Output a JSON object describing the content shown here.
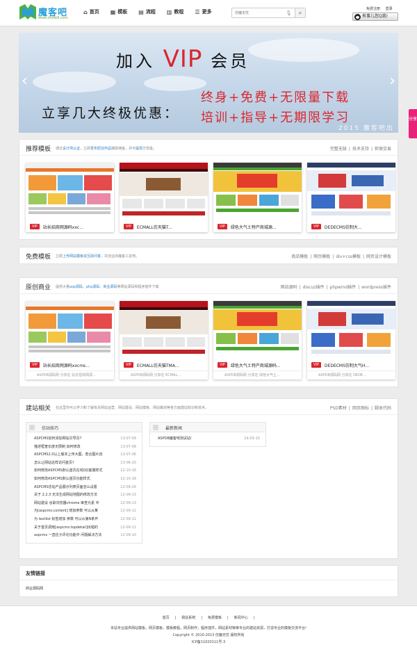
{
  "header": {
    "logo_text": "魔客吧",
    "logo_url": "www.moke8.com",
    "nav": [
      {
        "icon": "home-icon",
        "glyph": "⌂",
        "label": "首页"
      },
      {
        "icon": "grid-icon",
        "glyph": "▦",
        "label": "模板"
      },
      {
        "icon": "chart-icon",
        "glyph": "▤",
        "label": "流程"
      },
      {
        "icon": "book-icon",
        "glyph": "▥",
        "label": "教程"
      },
      {
        "icon": "menu-icon",
        "glyph": "☰",
        "label": "更多"
      }
    ],
    "search_placeholder": "仿魔无忧",
    "user_links": [
      "免费注册",
      "登录"
    ],
    "qq_label": "有事儿您Q我!"
  },
  "banner": {
    "line1_a": "加入",
    "line1_vip": "VIP",
    "line1_b": "会员",
    "line2": "立享几大终极优惠：",
    "red1": "终身+免费+无限量下载",
    "red2": "培训+指导+无期限学习",
    "year": "2015  魔客吧出品"
  },
  "share": "分享",
  "recommend": {
    "title": "推荐模板",
    "desc_a": "通过",
    "desc_b": "设计师认证",
    "desc_c": "，立即",
    "desc_d": "发布原创作品",
    "desc_e": "赚取佣金，并可",
    "desc_f": "提现",
    "desc_g": "方现金。",
    "links": [
      "完整无缺",
      "|",
      "技术支持",
      "|",
      "担保交易"
    ],
    "cards": [
      {
        "title": "站长招商网源码xxc..."
      },
      {
        "title": "ECMALL仿天猫T..."
      },
      {
        "title": "绿色大气土特产商城源..."
      },
      {
        "title": "DEDECMS仿制大..."
      }
    ]
  },
  "free": {
    "title": "免费模板",
    "desc_a": "立即",
    "desc_b": "上传网站模板",
    "desc_c": "或",
    "desc_d": "互助问答",
    "desc_e": "，并创业的魔客工友吧。",
    "links": [
      "商店模板",
      "|",
      "网页模板",
      "|",
      "div+css模板",
      "|",
      "网页设计模板"
    ]
  },
  "original": {
    "title": "原创商业",
    "desc_a": "提供大量",
    "desc_b": "asp源码",
    "desc_c": "、",
    "desc_d": "php源码",
    "desc_e": "、",
    "desc_f": "商业源码",
    "desc_g": "等网站源码和程序插件下载",
    "links": [
      "网站源码",
      "|",
      "discuz插件",
      "|",
      "phpwind插件",
      "|",
      "wordpress插件"
    ],
    "cards": [
      {
        "title": "站长招商网源码xxcms...",
        "author": "ASPDB源码网 分享在 站长招商网源..."
      },
      {
        "title": "ECMALL仿天猫TMA...",
        "author": "ASPDB源码网 分享在 ECMAL..."
      },
      {
        "title": "绿色大气土特产商城源码...",
        "author": "ASPDB源码网 分享在 绿色大气土..."
      },
      {
        "title": "DEDECMS仿制大气H...",
        "author": "ASPDB源码网 分享在 DEDE..."
      }
    ]
  },
  "build": {
    "title": "建站相关",
    "desc": "在这里你可以学习和了解有关网站运营、网站建设、网站模板、网站策划等各方面建站知识和技术。",
    "links": [
      "PSD素材",
      "|",
      "网页图标",
      "|",
      "脚本代码"
    ],
    "panel_a": {
      "title": "仿站技巧",
      "items": [
        {
          "text": "ASPCMS如何添加网站引导页?",
          "date": "13-07-09"
        },
        {
          "text": "描述框宽长度无限制 如何修改",
          "date": "13-07-08"
        },
        {
          "text": "ASPCMS2.0以上版本上传大图，若合图片自",
          "date": "13-07-06"
        },
        {
          "text": "怎么让网站这样访问首页?",
          "date": "13-06-20"
        },
        {
          "text": "如何修改ASPCMS默认首页在线QQ客服样式",
          "date": "12-10-18"
        },
        {
          "text": "如何修改ASPCMS默认首页功能样式",
          "date": "12-10-18"
        },
        {
          "text": "ASPCMS仿站产品展示列表页面怎么设置",
          "date": "12-09-26"
        },
        {
          "text": "关于 2.2.3 无法生成网站地图的修改方法",
          "date": "12-09-13"
        },
        {
          "text": "网站建设 谷歌浏览器chrome 审查元素 中",
          "date": "12-09-13"
        },
        {
          "text": "为[aspcms:content] 增加参数 可以从某",
          "date": "12-09-11"
        },
        {
          "text": "为 textlist 标签增加 参数 可以从第N条开",
          "date": "12-09-11"
        },
        {
          "text": "关于首页调用[aspcms:topdetail]出错的",
          "date": "12-09-11"
        },
        {
          "text": "aspcms 一直往子评论功能中 问题解决方法",
          "date": "12-09-10"
        }
      ]
    },
    "panel_b": {
      "title": "最新新闻",
      "items": [
        {
          "text": "ASPDB魔客吧测试站!",
          "date": "14-03-10"
        }
      ]
    }
  },
  "friend": {
    "title": "友情链接",
    "link": "商业源码网"
  },
  "footer": {
    "nav": [
      "首页",
      "|",
      "我站系统",
      "|",
      "免费模板",
      "|",
      "新闻中心",
      "|"
    ],
    "desc": "本站专业提供网站模板，网页模板，模板教程，网页制作，程序插件，网站素材等等专业的建站资源，打造专业的模板交流平台!",
    "copy": "Copyright © 2010-2013 仿魔无忧 版权所有",
    "icp": "ICP备11020111号-3"
  }
}
